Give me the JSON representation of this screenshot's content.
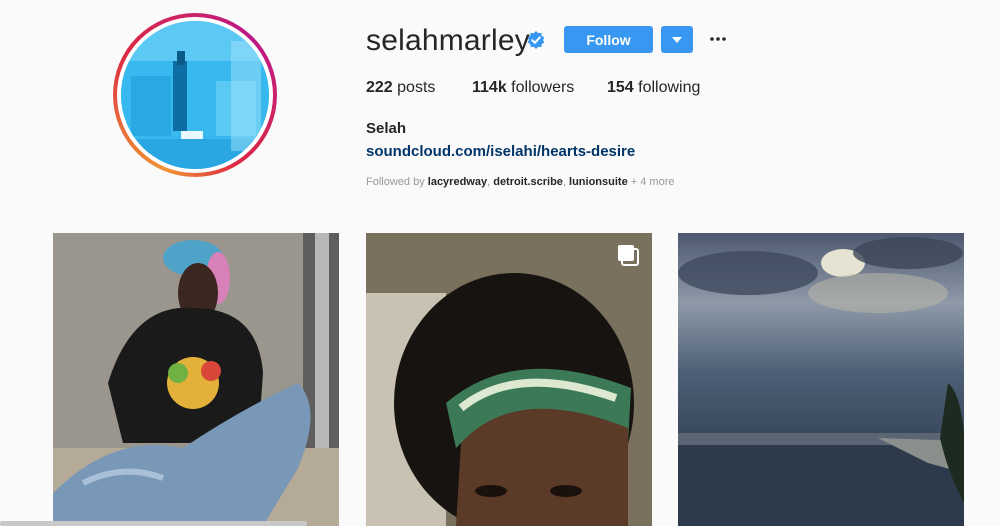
{
  "profile": {
    "username": "selahmarley",
    "verified": true,
    "follow_label": "Follow",
    "full_name": "Selah",
    "bio_link": "soundcloud.com/iselahi/hearts-desire"
  },
  "stats": {
    "posts_count": "222",
    "posts_label": " posts",
    "followers_count": "114k",
    "followers_label": " followers",
    "following_count": "154",
    "following_label": " following"
  },
  "followed_by": {
    "prefix": "Followed by ",
    "accounts": [
      "lacyredway",
      "detroit.scribe",
      "lunionsuite"
    ],
    "sep": ", ",
    "more": " + 4 more"
  },
  "icons": {
    "verified": "verified-badge-icon",
    "dropdown": "caret-down-icon",
    "more": "ellipsis-icon",
    "multi": "multiple-photos-icon"
  },
  "colors": {
    "accent": "#3897f0",
    "link": "#003569",
    "muted": "#999999"
  }
}
